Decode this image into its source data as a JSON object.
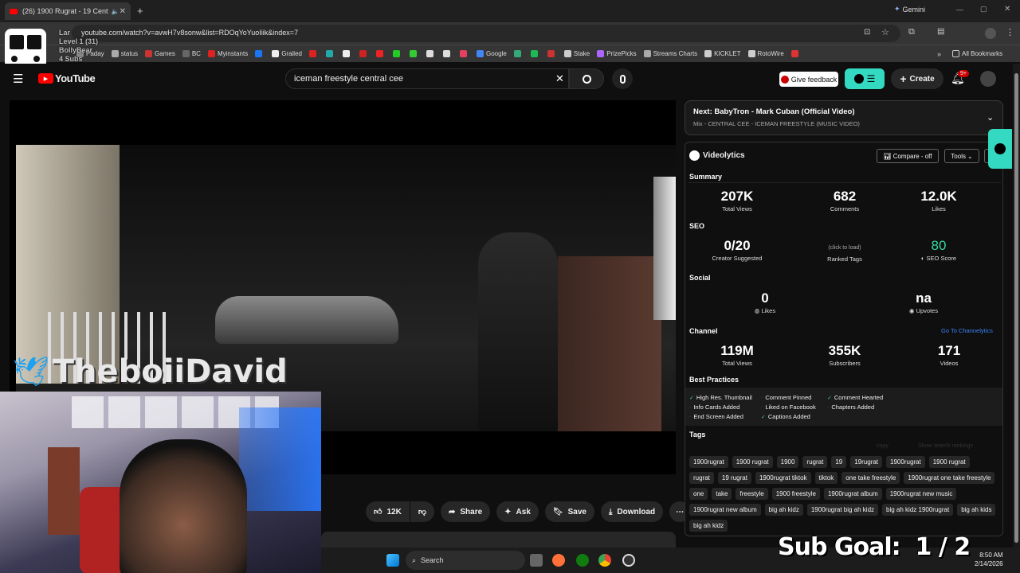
{
  "browser": {
    "tab_title": "(26) 1900 Rugrat - 19 Cent",
    "url": "youtube.com/watch?v=avwH7v8sonw&list=RDOqYoYuoIiik&index=7",
    "gemini": "Gemini",
    "all_bookmarks": "All Bookmarks"
  },
  "bookmarks": [
    {
      "label": "Paday",
      "color": "#888"
    },
    {
      "label": "status",
      "color": "#aaa"
    },
    {
      "label": "Games",
      "color": "#c33"
    },
    {
      "label": "BC",
      "color": "#666"
    },
    {
      "label": "Myinstants",
      "color": "#d22"
    },
    {
      "label": "",
      "color": "#1877f2"
    },
    {
      "label": "Grailed",
      "color": "#eee"
    },
    {
      "label": "",
      "color": "#d22"
    },
    {
      "label": "",
      "color": "#2aa"
    },
    {
      "label": "",
      "color": "#eee"
    },
    {
      "label": "",
      "color": "#c22"
    },
    {
      "label": "",
      "color": "#e22"
    },
    {
      "label": "",
      "color": "#2c2"
    },
    {
      "label": "",
      "color": "#3c3"
    },
    {
      "label": "",
      "color": "#ddd"
    },
    {
      "label": "",
      "color": "#ddd"
    },
    {
      "label": "",
      "color": "#e4405f"
    },
    {
      "label": "Google",
      "color": "#4285f4"
    },
    {
      "label": "",
      "color": "#3a7"
    },
    {
      "label": "",
      "color": "#1db954"
    },
    {
      "label": "",
      "color": "#c33"
    },
    {
      "label": "Stake",
      "color": "#ccc"
    },
    {
      "label": "PrizePicks",
      "color": "#a6f"
    },
    {
      "label": "Streams Charts",
      "color": "#aaa"
    },
    {
      "label": "KICKLET",
      "color": "#ccc"
    },
    {
      "label": "RotoWire",
      "color": "#ccc"
    },
    {
      "label": "",
      "color": "#d33"
    }
  ],
  "overlay": {
    "line1": "Lar",
    "line2": "Level 1 (31)",
    "line3": "BollyBear",
    "line4": "4 Subs"
  },
  "youtube": {
    "logo": "YouTube",
    "search_value": "iceman freestyle central cee",
    "give_feedback": "Give feedback",
    "create": "Create",
    "notif_badge": "9+"
  },
  "video": {
    "watermark": "TheboiiDavid"
  },
  "actions": {
    "likes": "12K",
    "share": "Share",
    "ask": "Ask",
    "save": "Save",
    "download": "Download"
  },
  "next": {
    "title": "Next: BabyTron - Mark Cuban (Official Video)",
    "subtitle": "Mix - CENTRAL CEE - ICEMAN FREESTYLE (MUSIC VIDEO)"
  },
  "videolytics": {
    "brand": "Videolytics",
    "compare": "Compare - off",
    "tools": "Tools",
    "summary_label": "Summary",
    "summary": [
      {
        "value": "207K",
        "label": "Total Views"
      },
      {
        "value": "682",
        "label": "Comments"
      },
      {
        "value": "12.0K",
        "label": "Likes"
      }
    ],
    "seo_label": "SEO",
    "seo": {
      "suggested_value": "0/20",
      "suggested_label": "Creator Suggested",
      "ranked_hint": "(click to load)",
      "ranked_label": "Ranked Tags",
      "score_value": "80",
      "score_label": "SEO Score"
    },
    "social_label": "Social",
    "social": [
      {
        "value": "0",
        "label": "Likes"
      },
      {
        "value": "na",
        "label": "Upvotes"
      }
    ],
    "channel_label": "Channel",
    "channel_link": "Go To Channelytics",
    "channel": [
      {
        "value": "119M",
        "label": "Total Views"
      },
      {
        "value": "355K",
        "label": "Subscribers"
      },
      {
        "value": "171",
        "label": "Videos"
      }
    ],
    "best_label": "Best Practices",
    "best": [
      "High Res. Thumbnail",
      "Comment Pinned",
      "Comment Hearted",
      "Info Cards Added",
      "Liked on Facebook",
      "Chapters Added",
      "End Screen Added",
      "Captions Added"
    ],
    "tags_label": "Tags",
    "copy": "copy",
    "show_rankings": "Show search rankings",
    "tags": [
      "1900rugrat",
      "1900 rugrat",
      "1900",
      "rugrat",
      "19",
      "19rugrat",
      "1900rugrat",
      "1900 rugrat",
      "rugrat",
      "19 rugrat",
      "1900rugrat tiktok",
      "tiktok",
      "one take freestyle",
      "1900rugrat one take freestyle",
      "one",
      "take",
      "freestyle",
      "1900 freestyle",
      "1900rugrat album",
      "1900rugrat new music",
      "1900rugrat new album",
      "big ah kidz",
      "1900rugrat big ah kidz",
      "big ah kidz 1900rugrat",
      "big ah kids",
      "big ah kidz"
    ]
  },
  "sub_goal": "Sub Goal:  1 / 2",
  "taskbar": {
    "search": "Search",
    "time": "8:50 AM",
    "date": "2/14/2026"
  }
}
